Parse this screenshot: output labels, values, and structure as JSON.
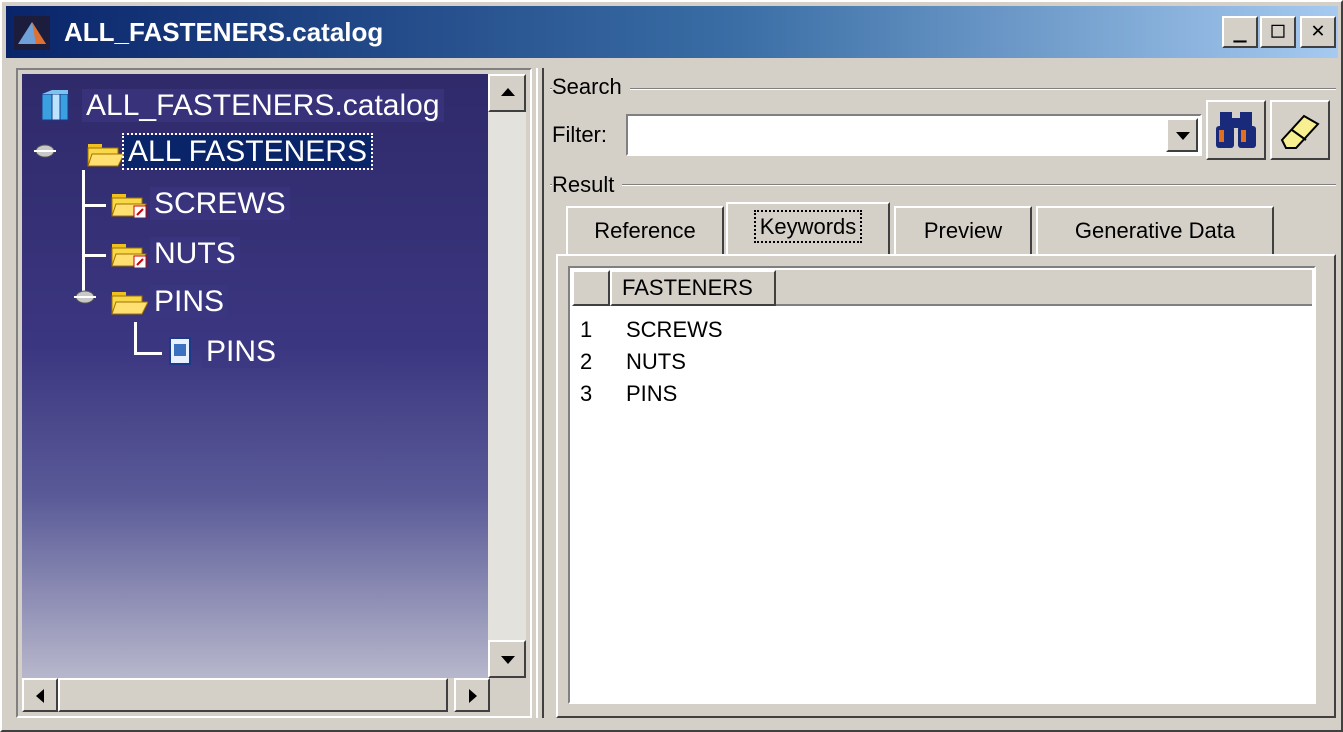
{
  "window": {
    "title": "ALL_FASTENERS.catalog",
    "minimize": "_",
    "maximize": "□",
    "close": "✕"
  },
  "tree": {
    "root": "ALL_FASTENERS.catalog",
    "nodes": [
      {
        "label": "ALL FASTENERS",
        "selected": true
      },
      {
        "label": "SCREWS"
      },
      {
        "label": "NUTS"
      },
      {
        "label": "PINS"
      },
      {
        "label": "PINS"
      }
    ]
  },
  "search": {
    "group_label": "Search",
    "filter_label": "Filter:",
    "filter_value": "",
    "search_icon": "binoculars-icon",
    "clear_icon": "eraser-icon"
  },
  "result": {
    "group_label": "Result",
    "tabs": [
      {
        "label": "Reference"
      },
      {
        "label": "Keywords",
        "active": true
      },
      {
        "label": "Preview"
      },
      {
        "label": "Generative Data"
      }
    ],
    "columns": [
      "FASTENERS"
    ],
    "rows": [
      {
        "num": "1",
        "value": "SCREWS"
      },
      {
        "num": "2",
        "value": "NUTS"
      },
      {
        "num": "3",
        "value": "PINS"
      }
    ]
  }
}
